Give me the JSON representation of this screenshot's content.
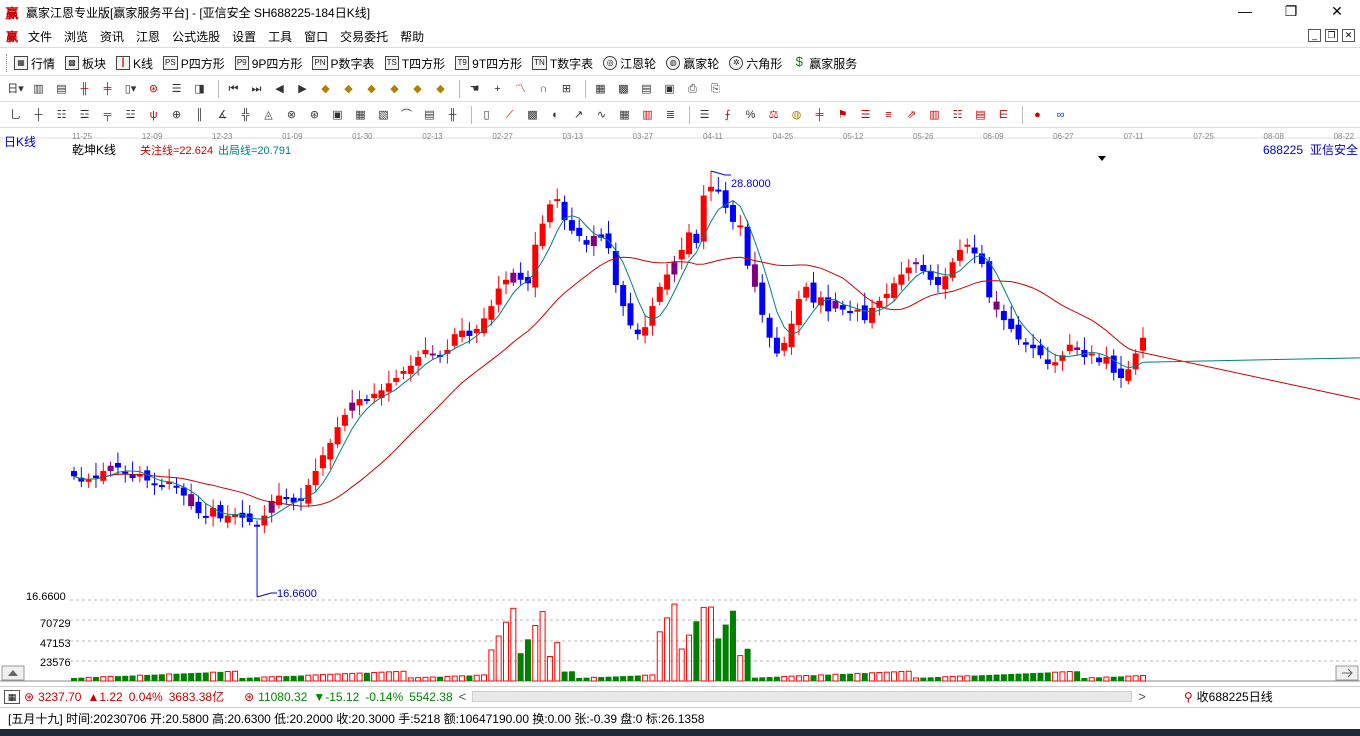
{
  "titlebar": {
    "logo": "赢",
    "title": "赢家江恩专业版[赢家服务平台] - [亚信安全   SH688225-184日K线]",
    "minimize": "—",
    "maximize": "❐",
    "close": "✕"
  },
  "menu": {
    "logo": "赢",
    "items": [
      "文件",
      "浏览",
      "资讯",
      "江恩",
      "公式选股",
      "设置",
      "工具",
      "窗口",
      "交易委托",
      "帮助"
    ],
    "mdi_min": "_",
    "mdi_restore": "❐",
    "mdi_close": "✕"
  },
  "nav": {
    "items": [
      {
        "label": "行情",
        "icon": "▦"
      },
      {
        "label": "板块",
        "icon": "▩"
      },
      {
        "label": "K线",
        "icon": "┃"
      },
      {
        "label": "P四方形",
        "icon": "PS"
      },
      {
        "label": "9P四方形",
        "icon": "P9"
      },
      {
        "label": "P数字表",
        "icon": "PN"
      },
      {
        "label": "T四方形",
        "icon": "TS"
      },
      {
        "label": "9T四方形",
        "icon": "T9"
      },
      {
        "label": "T数字表",
        "icon": "TN"
      },
      {
        "label": "江恩轮",
        "icon": "◎"
      },
      {
        "label": "赢家轮",
        "icon": "◍"
      },
      {
        "label": "六角形",
        "icon": "✲"
      },
      {
        "label": "赢家服务",
        "icon": "$"
      }
    ]
  },
  "chart_header": {
    "period": "日K线",
    "indicator": "乾坤K线",
    "attention_line": "关注线=22.624",
    "exit_line": "出局线=20.791",
    "symbol": "688225",
    "name": "亚信安全"
  },
  "chart_data": {
    "type": "candlestick",
    "date_ticks": [
      "11-25",
      "12-09",
      "12-23",
      "01-09",
      "01-30",
      "02-13",
      "02-27",
      "03-13",
      "03-27",
      "04-11",
      "04-25",
      "05-12",
      "05-26",
      "06-09",
      "06-27",
      "07-11",
      "07-25",
      "08-08",
      "08-22"
    ],
    "price_high_label": "28.8000",
    "price_low_label": "16.6600",
    "price_axis_label": "16.6600",
    "price_high": 28.8,
    "price_low": 16.66,
    "volume_ticks": [
      "70729",
      "47153",
      "23576"
    ],
    "volume_scale_max": 94305,
    "attention_line": 22.624,
    "exit_line": 20.791,
    "closes": [
      20.1,
      19.95,
      20.0,
      20.05,
      20.25,
      20.4,
      20.35,
      20.2,
      20.05,
      20.15,
      19.98,
      19.85,
      19.8,
      19.95,
      19.82,
      19.55,
      19.25,
      19.05,
      18.95,
      19.2,
      18.9,
      18.98,
      19.02,
      18.92,
      18.8,
      18.7,
      18.98,
      19.4,
      19.55,
      19.45,
      19.35,
      19.4,
      19.85,
      20.25,
      20.7,
      21.05,
      21.5,
      21.85,
      22.2,
      22.3,
      22.25,
      22.45,
      22.55,
      22.75,
      22.9,
      23.1,
      23.25,
      23.5,
      23.7,
      23.6,
      23.55,
      23.7,
      24.15,
      24.25,
      24.1,
      24.3,
      24.6,
      24.95,
      25.45,
      25.7,
      25.9,
      25.7,
      25.6,
      26.7,
      27.3,
      27.85,
      28.0,
      27.4,
      27.1,
      26.95,
      26.7,
      26.95,
      26.9,
      26.6,
      25.55,
      24.95,
      24.4,
      24.15,
      24.35,
      24.95,
      25.5,
      25.85,
      26.2,
      26.55,
      27.05,
      26.75,
      28.1,
      28.35,
      28.25,
      27.75,
      27.35,
      27.25,
      26.1,
      25.5,
      24.7,
      24.05,
      23.6,
      23.9,
      24.45,
      25.15,
      25.5,
      25.05,
      25.2,
      24.8,
      25.1,
      24.85,
      24.75,
      24.85,
      24.55,
      24.9,
      25.1,
      25.3,
      25.6,
      25.85,
      26.05,
      26.2,
      25.95,
      25.7,
      25.55,
      25.8,
      26.2,
      26.55,
      26.7,
      26.45,
      26.15,
      25.2,
      24.85,
      24.55,
      24.3,
      24.0,
      23.85,
      23.75,
      23.55,
      23.3,
      23.35,
      23.55,
      23.85,
      23.7,
      23.5,
      23.6,
      23.35,
      23.5,
      23.05,
      22.9,
      23.15,
      23.6,
      24.05
    ],
    "volume_profile": "Moderate volumes Nov–Jan, heavy spike volumes in mid-March and mid-April (max near 94305), tapering volumes from May–July"
  },
  "status": {
    "sh_index": "3237.70",
    "sh_change": "▲1.22",
    "sh_pct": "0.04%",
    "sh_amount": "3683.38亿",
    "sz_index": "11080.32",
    "sz_change": "▼-15.12",
    "sz_pct": "-0.14%",
    "sz_amount": "5542.38",
    "right_text": "收688225日线",
    "prev_arrow": "<",
    "next_arrow": ">"
  },
  "info": {
    "text": "[五月十九] 时间:20230706 开:20.5800 高:20.6300 低:20.2000 收:20.3000 手:5218 额:10647190.00 换:0.00 张:-0.39 盘:0 标:26.1358"
  },
  "colors": {
    "up": "#ff0000",
    "down": "#0000ff",
    "neutral": "#800080",
    "volume_up": "#ff0000",
    "volume_down": "#008000",
    "ma_red": "#cc0000",
    "ma_teal": "#008080"
  }
}
